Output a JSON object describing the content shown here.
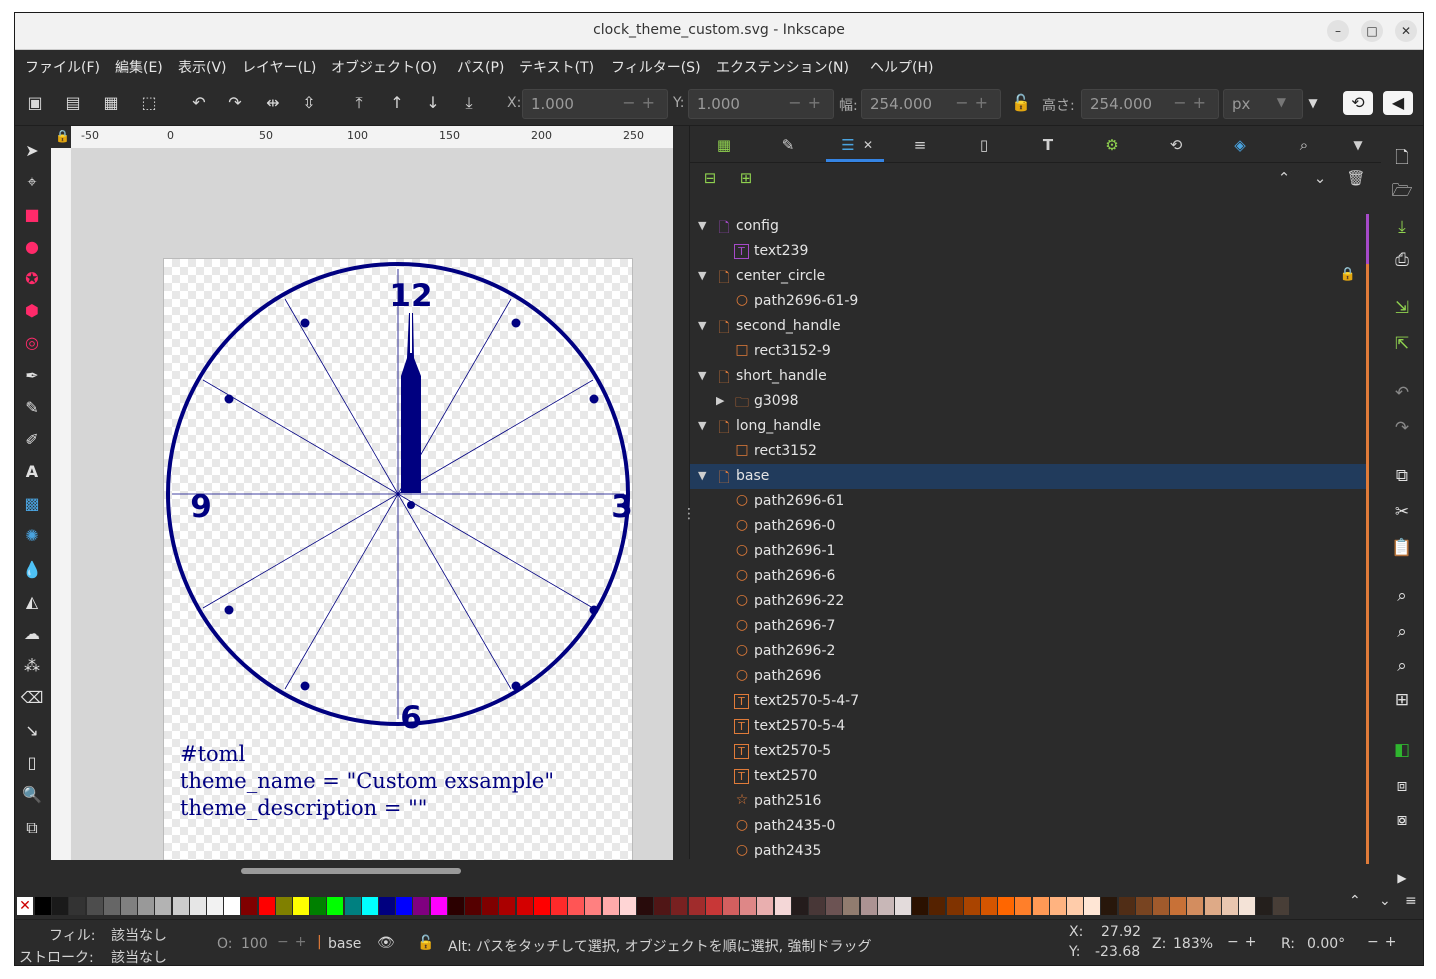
{
  "window": {
    "title": "clock_theme_custom.svg - Inkscape"
  },
  "menu": [
    "ファイル(F)",
    "編集(E)",
    "表示(V)",
    "レイヤー(L)",
    "オブジェクト(O)",
    "パス(P)",
    "テキスト(T)",
    "フィルター(S)",
    "エクステンション(N)",
    "ヘルプ(H)"
  ],
  "toolbar": {
    "x_label": "X:",
    "x_value": "1.000",
    "y_label": "Y:",
    "y_value": "1.000",
    "w_label": "幅:",
    "w_value": "254.000",
    "h_label": "高さ:",
    "h_value": "254.000",
    "unit": "px"
  },
  "ruler_h": [
    "-50",
    "0",
    "50",
    "100",
    "150",
    "200",
    "250"
  ],
  "clock": {
    "numerals": [
      "12",
      "3",
      "6",
      "9"
    ],
    "color": "#000080"
  },
  "toml_text": {
    "line1": "#toml",
    "line2": "theme_name = \"Custom exsample\"",
    "line3": "theme_description = \"\""
  },
  "layers": [
    {
      "label": "config",
      "kind": "layer",
      "expanded": true,
      "color": "#a64ac9"
    },
    {
      "label": "text239",
      "kind": "text",
      "color": "#a64ac9"
    },
    {
      "label": "center_circle",
      "kind": "layer",
      "expanded": true,
      "locked": true,
      "color": "#e07b39"
    },
    {
      "label": "path2696-61-9",
      "kind": "circle",
      "color": "#e07b39"
    },
    {
      "label": "second_handle",
      "kind": "layer",
      "expanded": true,
      "color": "#e07b39"
    },
    {
      "label": "rect3152-9",
      "kind": "rect",
      "color": "#e07b39"
    },
    {
      "label": "short_handle",
      "kind": "layer",
      "expanded": true,
      "color": "#e07b39"
    },
    {
      "label": "g3098",
      "kind": "group",
      "expanded": false,
      "color": "#e07b39"
    },
    {
      "label": "long_handle",
      "kind": "layer",
      "expanded": true,
      "color": "#e07b39"
    },
    {
      "label": "rect3152",
      "kind": "rect",
      "color": "#e07b39"
    },
    {
      "label": "base",
      "kind": "layer",
      "expanded": true,
      "selected": true,
      "color": "#e07b39"
    },
    {
      "label": "path2696-61",
      "kind": "circle",
      "color": "#e07b39"
    },
    {
      "label": "path2696-0",
      "kind": "circle",
      "color": "#e07b39"
    },
    {
      "label": "path2696-1",
      "kind": "circle",
      "color": "#e07b39"
    },
    {
      "label": "path2696-6",
      "kind": "circle",
      "color": "#e07b39"
    },
    {
      "label": "path2696-22",
      "kind": "circle",
      "color": "#e07b39"
    },
    {
      "label": "path2696-7",
      "kind": "circle",
      "color": "#e07b39"
    },
    {
      "label": "path2696-2",
      "kind": "circle",
      "color": "#e07b39"
    },
    {
      "label": "path2696",
      "kind": "circle",
      "color": "#e07b39"
    },
    {
      "label": "text2570-5-4-7",
      "kind": "text",
      "color": "#e07b39"
    },
    {
      "label": "text2570-5-4",
      "kind": "text",
      "color": "#e07b39"
    },
    {
      "label": "text2570-5",
      "kind": "text",
      "color": "#e07b39"
    },
    {
      "label": "text2570",
      "kind": "text",
      "color": "#e07b39"
    },
    {
      "label": "path2516",
      "kind": "star",
      "color": "#e07b39"
    },
    {
      "label": "path2435-0",
      "kind": "circle",
      "color": "#e07b39"
    },
    {
      "label": "path2435",
      "kind": "circle",
      "color": "#e07b39"
    }
  ],
  "status": {
    "fill_label": "フィル:",
    "fill_value": "該当なし",
    "stroke_label": "ストローク:",
    "stroke_value": "該当なし",
    "opacity_label": "O:",
    "opacity_value": "100",
    "layer": "base",
    "message": "Alt: パスをタッチして選択, オブジェクトを順に選択, 強制ドラッグ",
    "x_label": "X:",
    "x_value": "27.92",
    "y_label": "Y:",
    "y_value": "-23.68",
    "zoom_label": "Z:",
    "zoom_value": "183%",
    "rot_label": "R:",
    "rot_value": "0.00°"
  },
  "palette": [
    "#000000",
    "#1a1a1a",
    "#333333",
    "#4d4d4d",
    "#666666",
    "#808080",
    "#999999",
    "#b3b3b3",
    "#cccccc",
    "#e6e6e6",
    "#f2f2f2",
    "#ffffff",
    "#800000",
    "#ff0000",
    "#808000",
    "#ffff00",
    "#008000",
    "#00ff00",
    "#008080",
    "#00ffff",
    "#000080",
    "#0000ff",
    "#800080",
    "#ff00ff",
    "#2b0000",
    "#550000",
    "#800000",
    "#aa0000",
    "#d40000",
    "#ff0000",
    "#ff2a2a",
    "#ff5555",
    "#ff8080",
    "#ffaaaa",
    "#ffd5d5",
    "#280b0b",
    "#501616",
    "#782121",
    "#a02c2c",
    "#c83737",
    "#d35f5f",
    "#de8787",
    "#e9afaf",
    "#f4d7d7",
    "#241c1c",
    "#483737",
    "#6c5353",
    "#917c6f",
    "#ac9393",
    "#c8b7b7",
    "#e3dbdb",
    "#2b1100",
    "#552200",
    "#803300",
    "#aa4400",
    "#d45500",
    "#ff6600",
    "#ff7f2a",
    "#ff9955",
    "#ffb380",
    "#ffccaa",
    "#ffe6d5",
    "#28170b",
    "#502d16",
    "#784421",
    "#a05a2c",
    "#c87137",
    "#d38d5f",
    "#deaa87",
    "#e9c6af",
    "#f4e3d7",
    "#241f1c",
    "#483e37"
  ]
}
